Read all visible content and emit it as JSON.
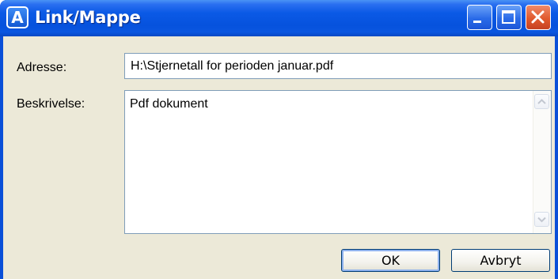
{
  "window": {
    "title": "Link/Mappe",
    "app_icon_letter": "A",
    "controls": {
      "minimize": "minimize",
      "maximize": "maximize",
      "close": "close"
    }
  },
  "form": {
    "address_label": "Adresse:",
    "address_value": "H:\\Stjernetall for perioden januar.pdf",
    "description_label": "Beskrivelse:",
    "description_value": "Pdf dokument"
  },
  "buttons": {
    "ok_label": "OK",
    "cancel_label": "Avbryt"
  },
  "colors": {
    "titlebar": "#0a56e0",
    "dialog_face": "#ece9d8",
    "close_button": "#e15a2e",
    "input_border": "#7f9db9"
  }
}
